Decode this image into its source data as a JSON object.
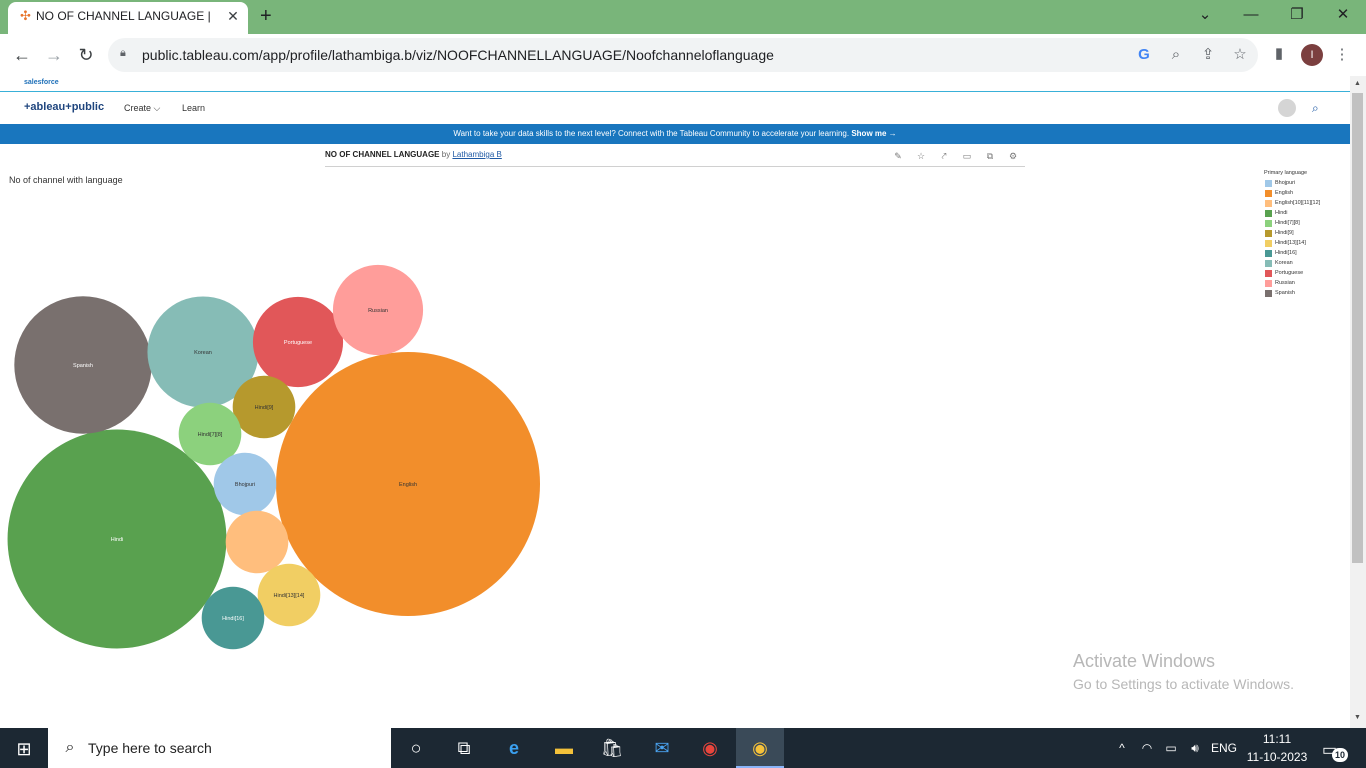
{
  "browser": {
    "tab_title": "NO OF CHANNEL LANGUAGE | T",
    "tab_close": "✕",
    "new_tab": "+",
    "url": "public.tableau.com/app/profile/lathambiga.b/viz/NOOFCHANNELLANGUAGE/Noofchanneloflanguage",
    "profile_initial": "I"
  },
  "site": {
    "salesforce": "salesforce",
    "logo": "+ableau+public",
    "nav": [
      "Create",
      "Learn"
    ],
    "banner_text": "Want to take your data skills to the next level? Connect with the Tableau Community to accelerate your learning.",
    "banner_link": "Show me →"
  },
  "viz": {
    "title": "NO OF CHANNEL LANGUAGE",
    "by": "by",
    "author": "Lathambiga B",
    "sheet_title": "No of channel with language"
  },
  "chart_data": {
    "type": "bubble",
    "legend_title": "Primary language",
    "legend": [
      {
        "label": "Bhojpuri",
        "color": "#a0c8e8"
      },
      {
        "label": "English",
        "color": "#f28e2b"
      },
      {
        "label": "English[10][11][12]",
        "color": "#ffbe7d"
      },
      {
        "label": "Hindi",
        "color": "#59a14f"
      },
      {
        "label": "Hindi[7][8]",
        "color": "#8cd17d"
      },
      {
        "label": "Hindi[9]",
        "color": "#b6992d"
      },
      {
        "label": "Hindi[13][14]",
        "color": "#f1ce63"
      },
      {
        "label": "Hindi[16]",
        "color": "#499894"
      },
      {
        "label": "Korean",
        "color": "#86bcb6"
      },
      {
        "label": "Portuguese",
        "color": "#e15759"
      },
      {
        "label": "Russian",
        "color": "#ff9d9a"
      },
      {
        "label": "Spanish",
        "color": "#79706e"
      }
    ],
    "bubbles": [
      {
        "label": "English",
        "color": "#f28e2b",
        "value": 48
      },
      {
        "label": "Hindi",
        "color": "#59a14f",
        "value": 33
      },
      {
        "label": "Spanish",
        "color": "#79706e",
        "value": 13
      },
      {
        "label": "Korean",
        "color": "#86bcb6",
        "value": 8.5
      },
      {
        "label": "Portuguese",
        "color": "#e15759",
        "value": 5.6
      },
      {
        "label": "Russian",
        "color": "#ff9d9a",
        "value": 5.6
      },
      {
        "label": "Hindi[9]",
        "color": "#b6992d",
        "value": 2.7
      },
      {
        "label": "Hindi[7][8]",
        "color": "#8cd17d",
        "value": 2.7
      },
      {
        "label": "Bhojpuri",
        "color": "#a0c8e8",
        "value": 2.7
      },
      {
        "label": "",
        "color": "#ffbe7d",
        "value": 2.7
      },
      {
        "label": "Hindi[13][14]",
        "color": "#f1ce63",
        "value": 2.7
      },
      {
        "label": "Hindi[16]",
        "color": "#499894",
        "value": 2.7
      }
    ]
  },
  "watermark": {
    "line1": "Activate Windows",
    "line2": "Go to Settings to activate Windows."
  },
  "taskbar": {
    "search_placeholder": "Type here to search",
    "language": "ENG",
    "time": "11:11",
    "date": "11-10-2023",
    "notifications": "10"
  }
}
